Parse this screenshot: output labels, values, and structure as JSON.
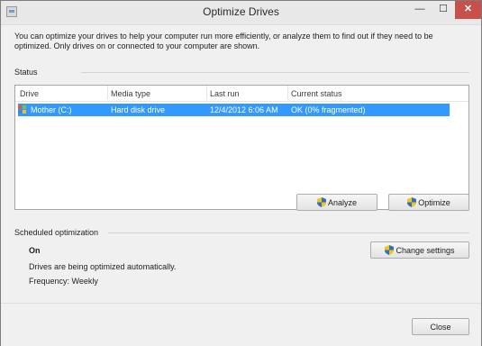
{
  "window": {
    "title": "Optimize Drives",
    "minimize_glyph": "—",
    "maximize_glyph": "☐",
    "close_glyph": "✕"
  },
  "intro_text": "You can optimize your drives to help your computer run more efficiently, or analyze them to find out if they need to be optimized. Only drives on or connected to your computer are shown.",
  "status": {
    "label": "Status",
    "columns": [
      "Drive",
      "Media type",
      "Last run",
      "Current status"
    ],
    "rows": [
      {
        "drive": "Mother (C:)",
        "media_type": "Hard disk drive",
        "last_run": "12/4/2012 6:06 AM",
        "current_status": "OK (0% fragmented)",
        "selected": true
      }
    ],
    "selection_color": "#3399ff"
  },
  "buttons": {
    "analyze": "Analyze",
    "optimize": "Optimize",
    "change_settings": "Change settings",
    "close": "Close"
  },
  "scheduled": {
    "label": "Scheduled optimization",
    "state": "On",
    "description": "Drives are being optimized automatically.",
    "frequency": "Frequency: Weekly"
  },
  "icons": {
    "shield": "uac-shield-icon",
    "drive": "drive-icon"
  }
}
